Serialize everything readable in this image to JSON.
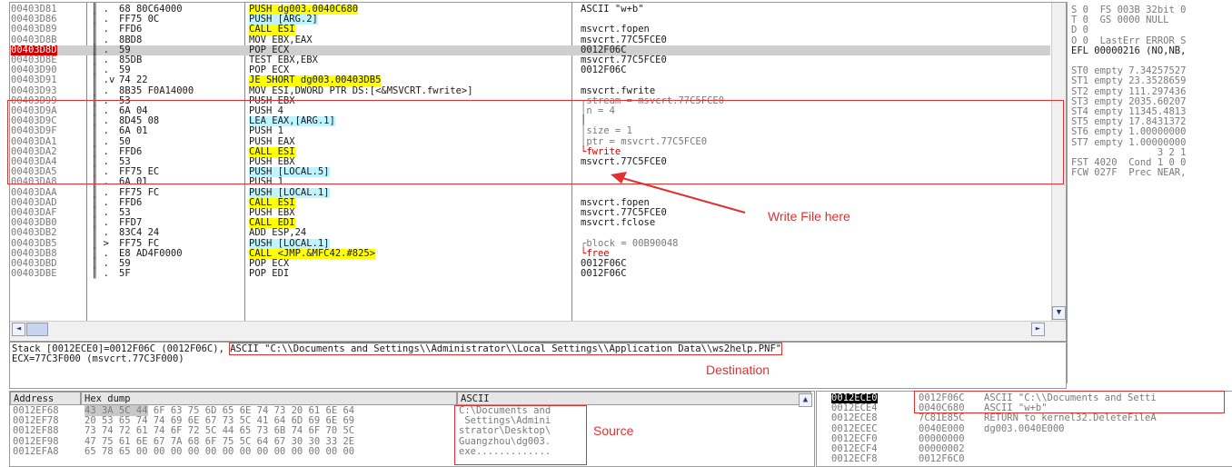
{
  "disasm": {
    "rows": [
      {
        "addr": "00403D81",
        "mark": "║ .",
        "hex": "68 80C64000",
        "instr": "PUSH dg003.0040C680",
        "comment": "ASCII \"w+b\""
      },
      {
        "addr": "00403D86",
        "mark": "║ .",
        "hex": "FF75 0C",
        "instr": "PUSH [ARG.2]",
        "comment": ""
      },
      {
        "addr": "00403D89",
        "mark": "║ .",
        "hex": "FFD6",
        "instr": "CALL ESI",
        "comment": "msvcrt.fopen"
      },
      {
        "addr": "00403D8B",
        "mark": "║ .",
        "hex": "8BD8",
        "instr": "MOV EBX,EAX",
        "comment": "msvcrt.77C5FCE0"
      },
      {
        "addr": "00403D8D",
        "mark": "║ .",
        "hex": "59",
        "instr": "POP ECX",
        "comment": "0012F06C"
      },
      {
        "addr": "00403D8E",
        "mark": "║ .",
        "hex": "85DB",
        "instr": "TEST EBX,EBX",
        "comment": "msvcrt.77C5FCE0"
      },
      {
        "addr": "00403D90",
        "mark": "║ .",
        "hex": "59",
        "instr": "POP ECX",
        "comment": "0012F06C"
      },
      {
        "addr": "00403D91",
        "mark": "║ .v",
        "hex": "74 22",
        "instr": "JE SHORT dg003.00403DB5",
        "comment": ""
      },
      {
        "addr": "00403D93",
        "mark": "║ .",
        "hex": "8B35 F0A14000",
        "instr": "MOV ESI,DWORD PTR DS:[<&MSVCRT.fwrite>]",
        "comment": "msvcrt.fwrite"
      },
      {
        "addr": "00403D99",
        "mark": "║ .",
        "hex": "53",
        "instr": "PUSH EBX",
        "comment": "┌stream = msvcrt.77C5FCE0"
      },
      {
        "addr": "00403D9A",
        "mark": "║ .",
        "hex": "6A 04",
        "instr": "PUSH 4",
        "comment": "│n = 4"
      },
      {
        "addr": "00403D9C",
        "mark": "║ .",
        "hex": "8D45 08",
        "instr": "LEA EAX,[ARG.1]",
        "comment": "│"
      },
      {
        "addr": "00403D9F",
        "mark": "║ .",
        "hex": "6A 01",
        "instr": "PUSH 1",
        "comment": "│size = 1"
      },
      {
        "addr": "00403DA1",
        "mark": "║ .",
        "hex": "50",
        "instr": "PUSH EAX",
        "comment": "│ptr = msvcrt.77C5FCE0"
      },
      {
        "addr": "00403DA2",
        "mark": "║ .",
        "hex": "FFD6",
        "instr": "CALL ESI",
        "comment": "└fwrite"
      },
      {
        "addr": "00403DA4",
        "mark": "║ .",
        "hex": "53",
        "instr": "PUSH EBX",
        "comment": "msvcrt.77C5FCE0"
      },
      {
        "addr": "00403DA5",
        "mark": "║ .",
        "hex": "FF75 EC",
        "instr": "PUSH [LOCAL.5]",
        "comment": ""
      },
      {
        "addr": "00403DA8",
        "mark": "║ .",
        "hex": "6A 01",
        "instr": "PUSH 1",
        "comment": ""
      },
      {
        "addr": "00403DAA",
        "mark": "║ .",
        "hex": "FF75 FC",
        "instr": "PUSH [LOCAL.1]",
        "comment": ""
      },
      {
        "addr": "00403DAD",
        "mark": "║ .",
        "hex": "FFD6",
        "instr": "CALL ESI",
        "comment": "msvcrt.fopen"
      },
      {
        "addr": "00403DAF",
        "mark": "║ .",
        "hex": "53",
        "instr": "PUSH EBX",
        "comment": "msvcrt.77C5FCE0"
      },
      {
        "addr": "00403DB0",
        "mark": "║ .",
        "hex": "FFD7",
        "instr": "CALL EDI",
        "comment": "msvcrt.fclose"
      },
      {
        "addr": "00403DB2",
        "mark": "║ .",
        "hex": "83C4 24",
        "instr": "ADD ESP,24",
        "comment": ""
      },
      {
        "addr": "00403DB5",
        "mark": "║ >",
        "hex": "FF75 FC",
        "instr": "PUSH [LOCAL.1]",
        "comment": "┌block = 00B90048"
      },
      {
        "addr": "00403DB8",
        "mark": "║ .",
        "hex": "E8 AD4F0000",
        "instr": "CALL <JMP.&MFC42.#825>",
        "comment": "└free"
      },
      {
        "addr": "00403DBD",
        "mark": "║ .",
        "hex": "59",
        "instr": "POP ECX",
        "comment": "0012F06C"
      },
      {
        "addr": "00403DBE",
        "mark": "║ .",
        "hex": "5F",
        "instr": "POP EDI",
        "comment": "0012F06C"
      }
    ],
    "annotation": "Write File here",
    "scroll_left": "◄",
    "scroll_right": "►",
    "scroll_down": "▼"
  },
  "registers": {
    "lines": [
      "S 0  FS 003B 32bit 0",
      "T 0  GS 0000 NULL",
      "D 0",
      "O 0  LastErr ERROR_S",
      "EFL 00000216 (NO,NB,",
      "",
      "ST0 empty 7.34257527",
      "ST1 empty 23.3528659",
      "ST2 empty 111.297436",
      "ST3 empty 2035.60207",
      "ST4 empty 11345.4813",
      "ST5 empty 17.8431372",
      "ST6 empty 1.00000000",
      "ST7 empty 1.00000000",
      "               3 2 1",
      "FST 4020  Cond 1 0 0",
      "FCW 027F  Prec NEAR,"
    ]
  },
  "info": {
    "line1_prefix": "Stack [0012ECE0]=0012F06C (0012F06C), ",
    "line1_boxed": "ASCII \"C:\\\\Documents and Settings\\\\Administrator\\\\Local Settings\\\\Application Data\\\\ws2help.PNF\"",
    "line2": "ECX=77C3F000 (msvcrt.77C3F000)",
    "annotation": "Destination"
  },
  "dump": {
    "headers": {
      "address": "Address",
      "hex": "Hex dump",
      "ascii": "ASCII"
    },
    "rows": [
      {
        "addr": "0012EF68",
        "hex": "43 3A 5C 44 6F 63 75 6D 65 6E 74 73 20 61 6E 64",
        "ascii": "C:\\Documents and"
      },
      {
        "addr": "0012EF78",
        "hex": "20 53 65 74 74 69 6E 67 73 5C 41 64 6D 69 6E 69",
        "ascii": " Settings\\Admini"
      },
      {
        "addr": "0012EF88",
        "hex": "73 74 72 61 74 6F 72 5C 44 65 73 6B 74 6F 70 5C",
        "ascii": "strator\\Desktop\\"
      },
      {
        "addr": "0012EF98",
        "hex": "47 75 61 6E 67 7A 68 6F 75 5C 64 67 30 30 33 2E",
        "ascii": "Guangzhou\\dg003."
      },
      {
        "addr": "0012EFA8",
        "hex": "65 78 65 00 00 00 00 00 00 00 00 00 00 00 00 00",
        "ascii": "exe............."
      }
    ],
    "annotation": "Source"
  },
  "stack": {
    "rows": [
      {
        "addr": "0012ECE0",
        "val": "0012F06C",
        "comment": "ASCII \"C:\\\\Documents and Setti"
      },
      {
        "addr": "0012ECE4",
        "val": "0040C680",
        "comment": "ASCII \"w+b\""
      },
      {
        "addr": "0012ECE8",
        "val": "7C81E85C",
        "comment": "RETURN to kernel32.DeleteFileA"
      },
      {
        "addr": "0012ECEC",
        "val": "0040E000",
        "comment": "dg003.0040E000"
      },
      {
        "addr": "0012ECF0",
        "val": "00000000",
        "comment": ""
      },
      {
        "addr": "0012ECF4",
        "val": "00000002",
        "comment": ""
      },
      {
        "addr": "0012ECF8",
        "val": "0012F6C0",
        "comment": ""
      }
    ]
  }
}
